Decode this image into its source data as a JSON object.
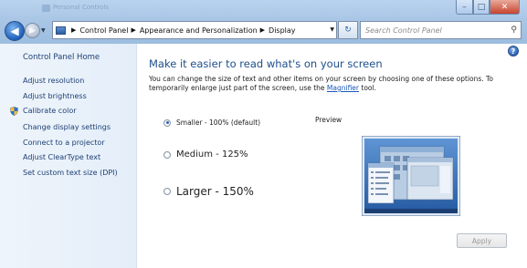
{
  "window": {
    "title": "Personal Controls",
    "controls": {
      "minimize": "–",
      "maximize": "□",
      "close": "✕"
    }
  },
  "nav": {
    "back_glyph": "◀",
    "forward_glyph": "▶",
    "dropdown_glyph": "▼"
  },
  "address": {
    "crumbs": [
      "Control Panel",
      "Appearance and Personalization",
      "Display"
    ],
    "separator": "▶",
    "dropdown_glyph": "▼"
  },
  "refresh_glyph": "↻",
  "search": {
    "placeholder": "Search Control Panel",
    "value": "",
    "icon": "⚲"
  },
  "sidebar": {
    "home": "Control Panel Home",
    "items": [
      {
        "label": "Adjust resolution"
      },
      {
        "label": "Adjust brightness"
      },
      {
        "label": "Calibrate color"
      },
      {
        "label": "Change display settings"
      },
      {
        "label": "Connect to a projector"
      },
      {
        "label": "Adjust ClearType text"
      },
      {
        "label": "Set custom text size (DPI)"
      }
    ]
  },
  "main": {
    "help": "?",
    "heading": "Make it easier to read what's on your screen",
    "description_before": "You can change the size of text and other items on your screen by choosing one of these options. To temporarily enlarge just part of the screen, use the ",
    "description_link": "Magnifier",
    "description_after": " tool.",
    "options": [
      {
        "label": "Smaller - 100% (default)",
        "selected": true
      },
      {
        "label": "Medium - 125%",
        "selected": false
      },
      {
        "label": "Larger - 150%",
        "selected": false
      }
    ],
    "preview_label": "Preview",
    "apply_label": "Apply",
    "apply_enabled": false
  },
  "colors": {
    "link": "#1d3f73",
    "heading": "#1e4e8c",
    "accent": "#2b62b0",
    "frame": "#a9c6e6",
    "close": "#c8442d"
  }
}
